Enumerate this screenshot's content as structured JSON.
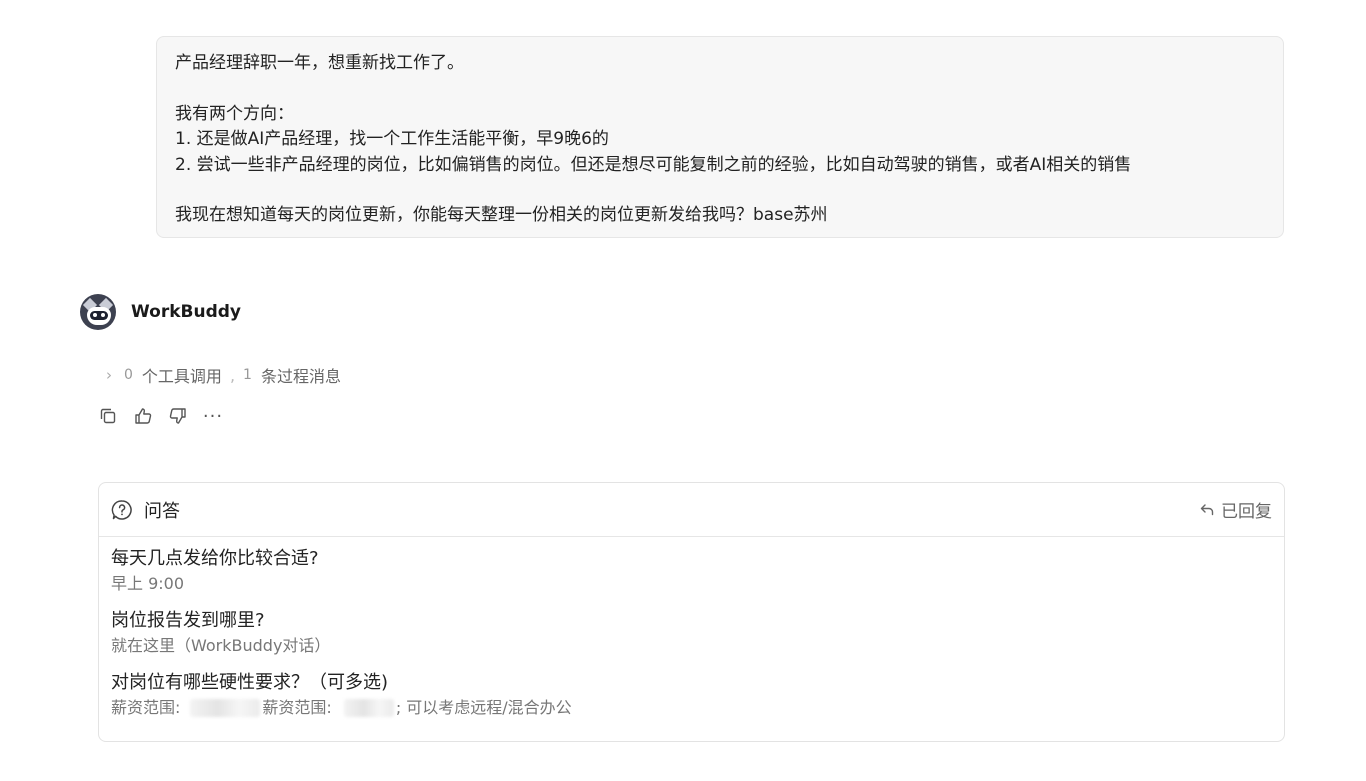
{
  "user_message": {
    "line1": "产品经理辞职一年，想重新找工作了。",
    "line2": "我有两个方向：",
    "line3": "1. 还是做AI产品经理，找一个工作生活能平衡，早9晚6的",
    "line4": "2. 尝试一些非产品经理的岗位，比如偏销售的岗位。但还是想尽可能复制之前的经验，比如自动驾驶的销售，或者AI相关的销售",
    "line5": "我现在想知道每天的岗位更新，你能每天整理一份相关的岗位更新发给我吗？base苏州"
  },
  "assistant": {
    "name": "WorkBuddy",
    "avatar_icon": "raccoon-avatar-icon"
  },
  "process": {
    "tool_calls_count": "0",
    "tool_calls_label": "个工具调用",
    "separator": ",",
    "process_msgs_count": "1",
    "process_msgs_label": "条过程消息"
  },
  "actions": {
    "copy_icon": "copy-icon",
    "like_icon": "thumbs-up-icon",
    "dislike_icon": "thumbs-down-icon",
    "more_label": "···"
  },
  "qa_card": {
    "title": "问答",
    "status": "已回复",
    "items": [
      {
        "question": "每天几点发给你比较合适?",
        "answer": "早上 9:00"
      },
      {
        "question": "岗位报告发到哪里?",
        "answer": "就在这里（WorkBuddy对话）"
      },
      {
        "question": "对岗位有哪些硬性要求？（可多选)",
        "answer_prefix": "薪资范围:",
        "answer_mid": "薪资范围:",
        "answer_suffix": "; 可以考虑远程/混合办公"
      }
    ]
  },
  "colors": {
    "bubble_bg": "#f7f7f7",
    "border": "#e3e3e3",
    "muted_text": "#777777"
  }
}
